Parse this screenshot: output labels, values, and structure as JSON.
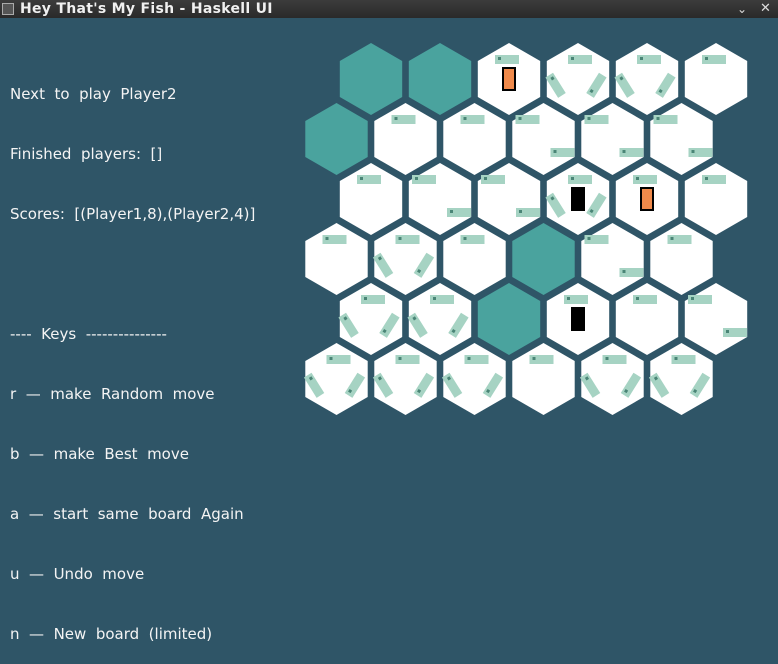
{
  "window": {
    "title": "Hey That's My Fish - Haskell UI",
    "chevron_icon": "chevron-down-icon",
    "close_icon": "close-icon"
  },
  "status": {
    "next_to_play": "Next  to  play  Player2",
    "finished_players": "Finished  players:  []",
    "scores": "Scores:  [(Player1,8),(Player2,4)]"
  },
  "keys": {
    "header": "----  Keys  ---------------",
    "items": [
      "r  —  make  Random  move",
      "b  —  make  Best  move",
      "a  —  start  same  board  Again",
      "u  —  Undo  move",
      "n  —  New  board  (limited)"
    ]
  },
  "colors": {
    "background": "#2f5567",
    "tile": "#ffffff",
    "empty_tile": "#4aa39e",
    "fish": "#a6d3c3",
    "player1": "#f08a4b",
    "player2": "#000000"
  },
  "board": {
    "rows": [
      [
        {
          "state": "empty"
        },
        {
          "state": "empty"
        },
        {
          "state": "tile",
          "fish": 1,
          "penguin": "player1"
        },
        {
          "state": "tile",
          "fish": 3
        },
        {
          "state": "tile",
          "fish": 3
        },
        {
          "state": "tile",
          "fish": 1
        }
      ],
      [
        {
          "state": "empty"
        },
        {
          "state": "tile",
          "fish": 1
        },
        {
          "state": "tile",
          "fish": 1
        },
        {
          "state": "tile",
          "fish": 2
        },
        {
          "state": "tile",
          "fish": 2
        },
        {
          "state": "tile",
          "fish": 2
        }
      ],
      [
        {
          "state": "tile",
          "fish": 1
        },
        {
          "state": "tile",
          "fish": 2
        },
        {
          "state": "tile",
          "fish": 2
        },
        {
          "state": "tile",
          "fish": 3,
          "penguin": "player2"
        },
        {
          "state": "tile",
          "fish": 1,
          "penguin": "player1"
        },
        {
          "state": "tile",
          "fish": 1
        }
      ],
      [
        {
          "state": "tile",
          "fish": 1
        },
        {
          "state": "tile",
          "fish": 3
        },
        {
          "state": "tile",
          "fish": 1
        },
        {
          "state": "empty"
        },
        {
          "state": "tile",
          "fish": 2
        },
        {
          "state": "tile",
          "fish": 1
        }
      ],
      [
        {
          "state": "tile",
          "fish": 3
        },
        {
          "state": "tile",
          "fish": 3
        },
        {
          "state": "empty"
        },
        {
          "state": "tile",
          "fish": 1,
          "penguin": "player2"
        },
        {
          "state": "tile",
          "fish": 1
        },
        {
          "state": "tile",
          "fish": 2
        }
      ],
      [
        {
          "state": "tile",
          "fish": 3
        },
        {
          "state": "tile",
          "fish": 3
        },
        {
          "state": "tile",
          "fish": 3
        },
        {
          "state": "tile",
          "fish": 1
        },
        {
          "state": "tile",
          "fish": 3
        },
        {
          "state": "tile",
          "fish": 3
        }
      ]
    ]
  }
}
